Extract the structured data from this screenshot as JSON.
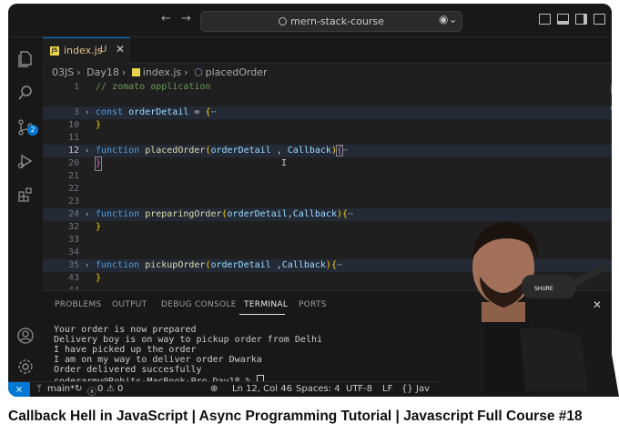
{
  "window": {
    "search_text": "mern-stack-course",
    "back_icon": "arrow-left-icon",
    "forward_icon": "arrow-right-icon"
  },
  "tab": {
    "file": "index.js",
    "modified_flag": "U",
    "close": "✕"
  },
  "breadcrumb": {
    "folder1": "03JS",
    "folder2": "Day18",
    "file": "index.js",
    "symbol": "placedOrder",
    "sep": "›"
  },
  "editor": {
    "lines": [
      {
        "n": "1",
        "text": "// zomato application"
      },
      {
        "n": "3",
        "text": "const orderDetail = {"
      },
      {
        "n": "10",
        "text": "}"
      },
      {
        "n": "11",
        "text": ""
      },
      {
        "n": "12",
        "text": "function placedOrder(orderDetail , Callback){"
      },
      {
        "n": "20",
        "text": "}"
      },
      {
        "n": "21",
        "text": ""
      },
      {
        "n": "22",
        "text": ""
      },
      {
        "n": "23",
        "text": ""
      },
      {
        "n": "24",
        "text": "function preparingOrder(orderDetail,Callback){"
      },
      {
        "n": "32",
        "text": "}"
      },
      {
        "n": "33",
        "text": ""
      },
      {
        "n": "34",
        "text": ""
      },
      {
        "n": "35",
        "text": "function pickupOrder(orderDetail ,Callback){"
      },
      {
        "n": "43",
        "text": "}"
      },
      {
        "n": "44",
        "text": ""
      }
    ],
    "active_line": "12",
    "fold_ellipsis": "⋯"
  },
  "panel": {
    "tabs": [
      "PROBLEMS",
      "OUTPUT",
      "DEBUG CONSOLE",
      "TERMINAL",
      "PORTS"
    ],
    "active_tab": "TERMINAL",
    "terminal_lines": [
      "Your order is now prepared",
      "Delivery boy is on way to pickup order from Delhi",
      "I have picked up the order",
      "I am on my way to deliver order Dwarka",
      "Order delivered succesfully",
      "coderarmy@Rohits-MacBook-Pro Day18 % "
    ]
  },
  "status": {
    "branch": "main*",
    "errors": "0",
    "warnings": "0",
    "position": "Ln 12, Col 46",
    "spaces": "Spaces: 4",
    "encoding": "UTF-8",
    "eol": "LF",
    "language": "Jav"
  },
  "activity": {
    "scm_badge": "2"
  },
  "video_title": "Callback Hell in JavaScript | Async Programming Tutorial | Javascript Full Course #18",
  "colors": {
    "accent": "#0078d4",
    "editor_bg": "#1f1f1f",
    "keyword": "#569cd6",
    "function": "#dcdcaa",
    "param": "#9cdcfe",
    "comment": "#6a9955"
  }
}
